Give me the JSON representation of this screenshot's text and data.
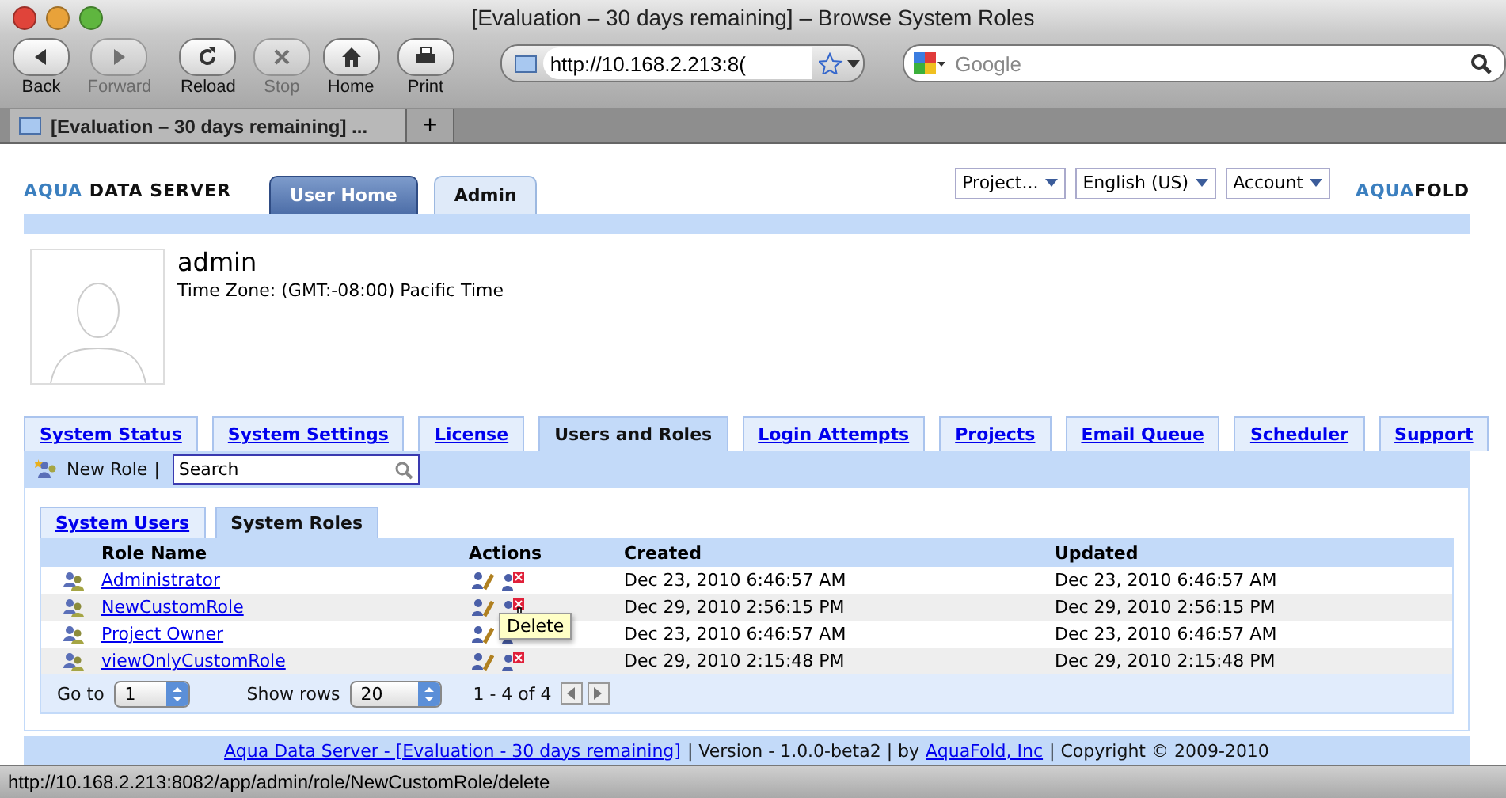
{
  "browser": {
    "title": "[Evaluation – 30 days remaining] – Browse System Roles",
    "nav_buttons": [
      {
        "kind": "back",
        "label": "Back",
        "disabled": false
      },
      {
        "kind": "forward",
        "label": "Forward",
        "disabled": true
      },
      {
        "kind": "reload",
        "label": "Reload",
        "disabled": false
      },
      {
        "kind": "stop",
        "label": "Stop",
        "disabled": true
      },
      {
        "kind": "home",
        "label": "Home",
        "disabled": false
      },
      {
        "kind": "print",
        "label": "Print",
        "disabled": false
      }
    ],
    "url": "http://10.168.2.213:8(",
    "search_placeholder": "Google",
    "tab_title": "[Evaluation – 30 days remaining] ...",
    "new_tab": "+",
    "status_url": "http://10.168.2.213:8082/app/admin/role/NewCustomRole/delete"
  },
  "app": {
    "logo_left": {
      "first": "AQUA",
      "rest": " DATA SERVER"
    },
    "logo_right": {
      "first": "AQUA",
      "rest": "FOLD"
    },
    "top_tabs": [
      {
        "label": "User Home",
        "selected": false
      },
      {
        "label": "Admin",
        "selected": true
      }
    ],
    "menus": [
      "Project...",
      "English (US)",
      "Account"
    ]
  },
  "profile": {
    "name": "admin",
    "timezone": "Time Zone: (GMT:-08:00) Pacific Time"
  },
  "admin_tabs": [
    {
      "label": "System Status",
      "selected": false
    },
    {
      "label": "System Settings",
      "selected": false
    },
    {
      "label": "License",
      "selected": false
    },
    {
      "label": "Users and Roles",
      "selected": true
    },
    {
      "label": "Login Attempts",
      "selected": false
    },
    {
      "label": "Projects",
      "selected": false
    },
    {
      "label": "Email Queue",
      "selected": false
    },
    {
      "label": "Scheduler",
      "selected": false
    },
    {
      "label": "Support",
      "selected": false
    }
  ],
  "toolbar": {
    "new_role": "New Role",
    "separator": "|",
    "search_value": "Search"
  },
  "sub_tabs": [
    {
      "label": "System Users",
      "selected": false
    },
    {
      "label": "System Roles",
      "selected": true
    }
  ],
  "table": {
    "columns": [
      "Role Name",
      "Actions",
      "Created",
      "Updated"
    ],
    "rows": [
      {
        "name": "Administrator",
        "created": "Dec 23, 2010 6:46:57 AM",
        "updated": "Dec 23, 2010 6:46:57 AM"
      },
      {
        "name": "NewCustomRole",
        "created": "Dec 29, 2010 2:56:15 PM",
        "updated": "Dec 29, 2010 2:56:15 PM"
      },
      {
        "name": "Project Owner",
        "created": "Dec 23, 2010 6:46:57 AM",
        "updated": "Dec 23, 2010 6:46:57 AM"
      },
      {
        "name": "viewOnlyCustomRole",
        "created": "Dec 29, 2010 2:15:48 PM",
        "updated": "Dec 29, 2010 2:15:48 PM"
      }
    ]
  },
  "pager": {
    "goto_label": "Go to",
    "page": "1",
    "show_rows_label": "Show rows",
    "rows": "20",
    "range": "1 - 4 of 4"
  },
  "tooltip": "Delete",
  "footer": {
    "product_link": "Aqua Data Server - [Evaluation - 30 days remaining]",
    "version": "| Version - 1.0.0-beta2 | by",
    "company_link": "AquaFold, Inc",
    "copyright": "| Copyright © 2009-2010"
  }
}
